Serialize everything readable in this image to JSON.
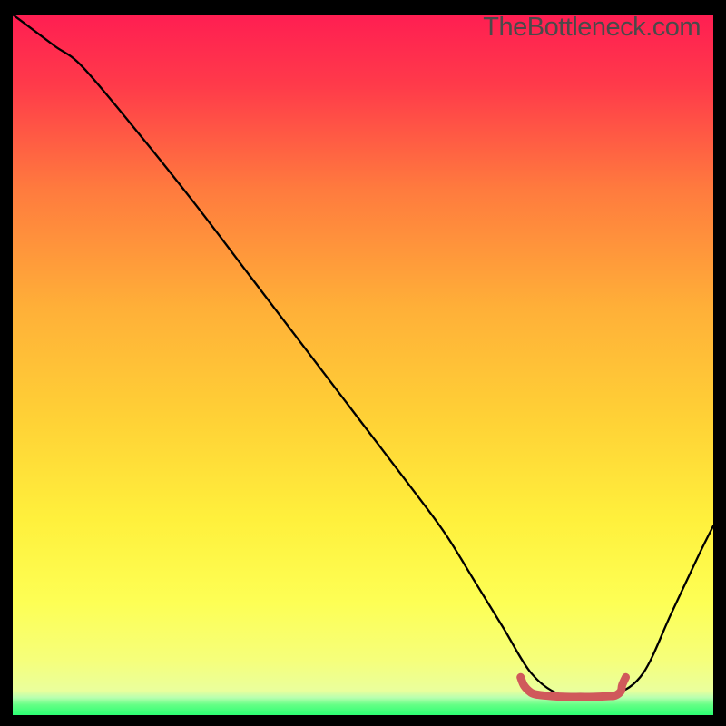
{
  "watermark": "TheBottleneck.com",
  "chart_data": {
    "type": "line",
    "title": "",
    "xlabel": "",
    "ylabel": "",
    "xlim": [
      0,
      100
    ],
    "ylim": [
      0,
      100
    ],
    "background_gradient": {
      "top": "#ff1e52",
      "upper_mid": "#ff7b3e",
      "mid": "#ffd236",
      "lower_mid": "#fff84a",
      "low": "#f6ff7a",
      "bottom_edge": "#2cff73"
    },
    "series": [
      {
        "name": "bottleneck-curve",
        "color": "#000000",
        "x": [
          0,
          2,
          6,
          10,
          18,
          26,
          34,
          42,
          50,
          58,
          62,
          66,
          70,
          74,
          78,
          82,
          86,
          90,
          94,
          98,
          100
        ],
        "y": [
          100,
          98.5,
          95.5,
          92.5,
          83,
          73,
          62.5,
          52,
          41.5,
          31,
          25.5,
          19,
          12.5,
          6,
          3,
          3,
          3,
          6,
          14.5,
          23,
          27
        ]
      },
      {
        "name": "minimum-highlight",
        "color": "#d0595b",
        "x": [
          72.5,
          73,
          74,
          75,
          77,
          79,
          81,
          83,
          85,
          86,
          86.8,
          87,
          87.5
        ],
        "y": [
          5.4,
          4.2,
          3.2,
          2.9,
          2.7,
          2.6,
          2.6,
          2.6,
          2.7,
          2.8,
          3.4,
          4.3,
          5.4
        ]
      }
    ]
  }
}
